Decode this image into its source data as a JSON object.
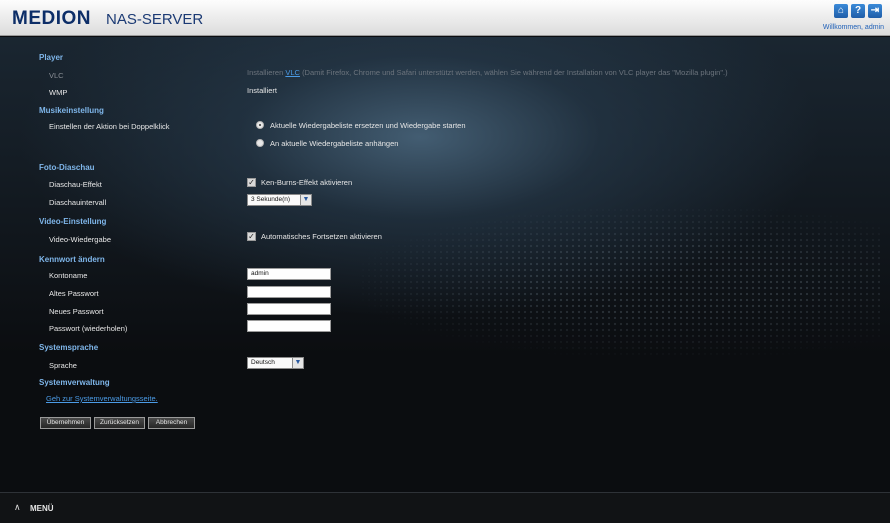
{
  "header": {
    "logo": "MEDION",
    "product": "NAS-SERVER",
    "icons": [
      "home-icon",
      "help-icon",
      "logout-icon"
    ],
    "icon_glyphs": {
      "home": "⌂",
      "help": "?",
      "logout": "⇥"
    },
    "welcome": "Willkommen, admin"
  },
  "player": {
    "title": "Player",
    "vlc_label": "VLC",
    "vlc_prefix": "Installieren",
    "vlc_link": "VLC",
    "vlc_suffix": "(Damit Firefox, Chrome und Safari unterstützt werden, wählen Sie während der Installation von VLC player das \"Mozilla plugin\".)",
    "wmp_label": "WMP",
    "wmp_value": "Installiert"
  },
  "music": {
    "title": "Musikeinstellung",
    "action_label": "Einstellen der Aktion bei Doppelklick",
    "option_replace": "Aktuelle Wiedergabeliste ersetzen und Wiedergabe starten",
    "option_append": "An aktuelle Wiedergabeliste anhängen",
    "selected": "replace"
  },
  "slideshow": {
    "title": "Foto-Diaschau",
    "effect_label": "Diaschau-Effekt",
    "effect_option": "Ken-Burns-Effekt aktivieren",
    "effect_checked": true,
    "interval_label": "Diaschauintervall",
    "interval_value": "3 Sekunde(n)"
  },
  "video": {
    "title": "Video-Einstellung",
    "playback_label": "Video-Wiedergabe",
    "resume_option": "Automatisches Fortsetzen aktivieren",
    "resume_checked": true
  },
  "password": {
    "title": "Kennwort ändern",
    "account_label": "Kontoname",
    "account_value": "admin",
    "old_label": "Altes Passwort",
    "new_label": "Neues Passwort",
    "repeat_label": "Passwort (wiederholen)"
  },
  "language": {
    "title": "Systemsprache",
    "label": "Sprache",
    "value": "Deutsch"
  },
  "system": {
    "title": "Systemverwaltung",
    "link": "Geh zur Systemverwaltungsseite."
  },
  "buttons": {
    "apply": "Übernehmen",
    "reset": "Zurücksetzen",
    "cancel": "Abbrechen"
  },
  "footer": {
    "menu": "MENÜ"
  }
}
